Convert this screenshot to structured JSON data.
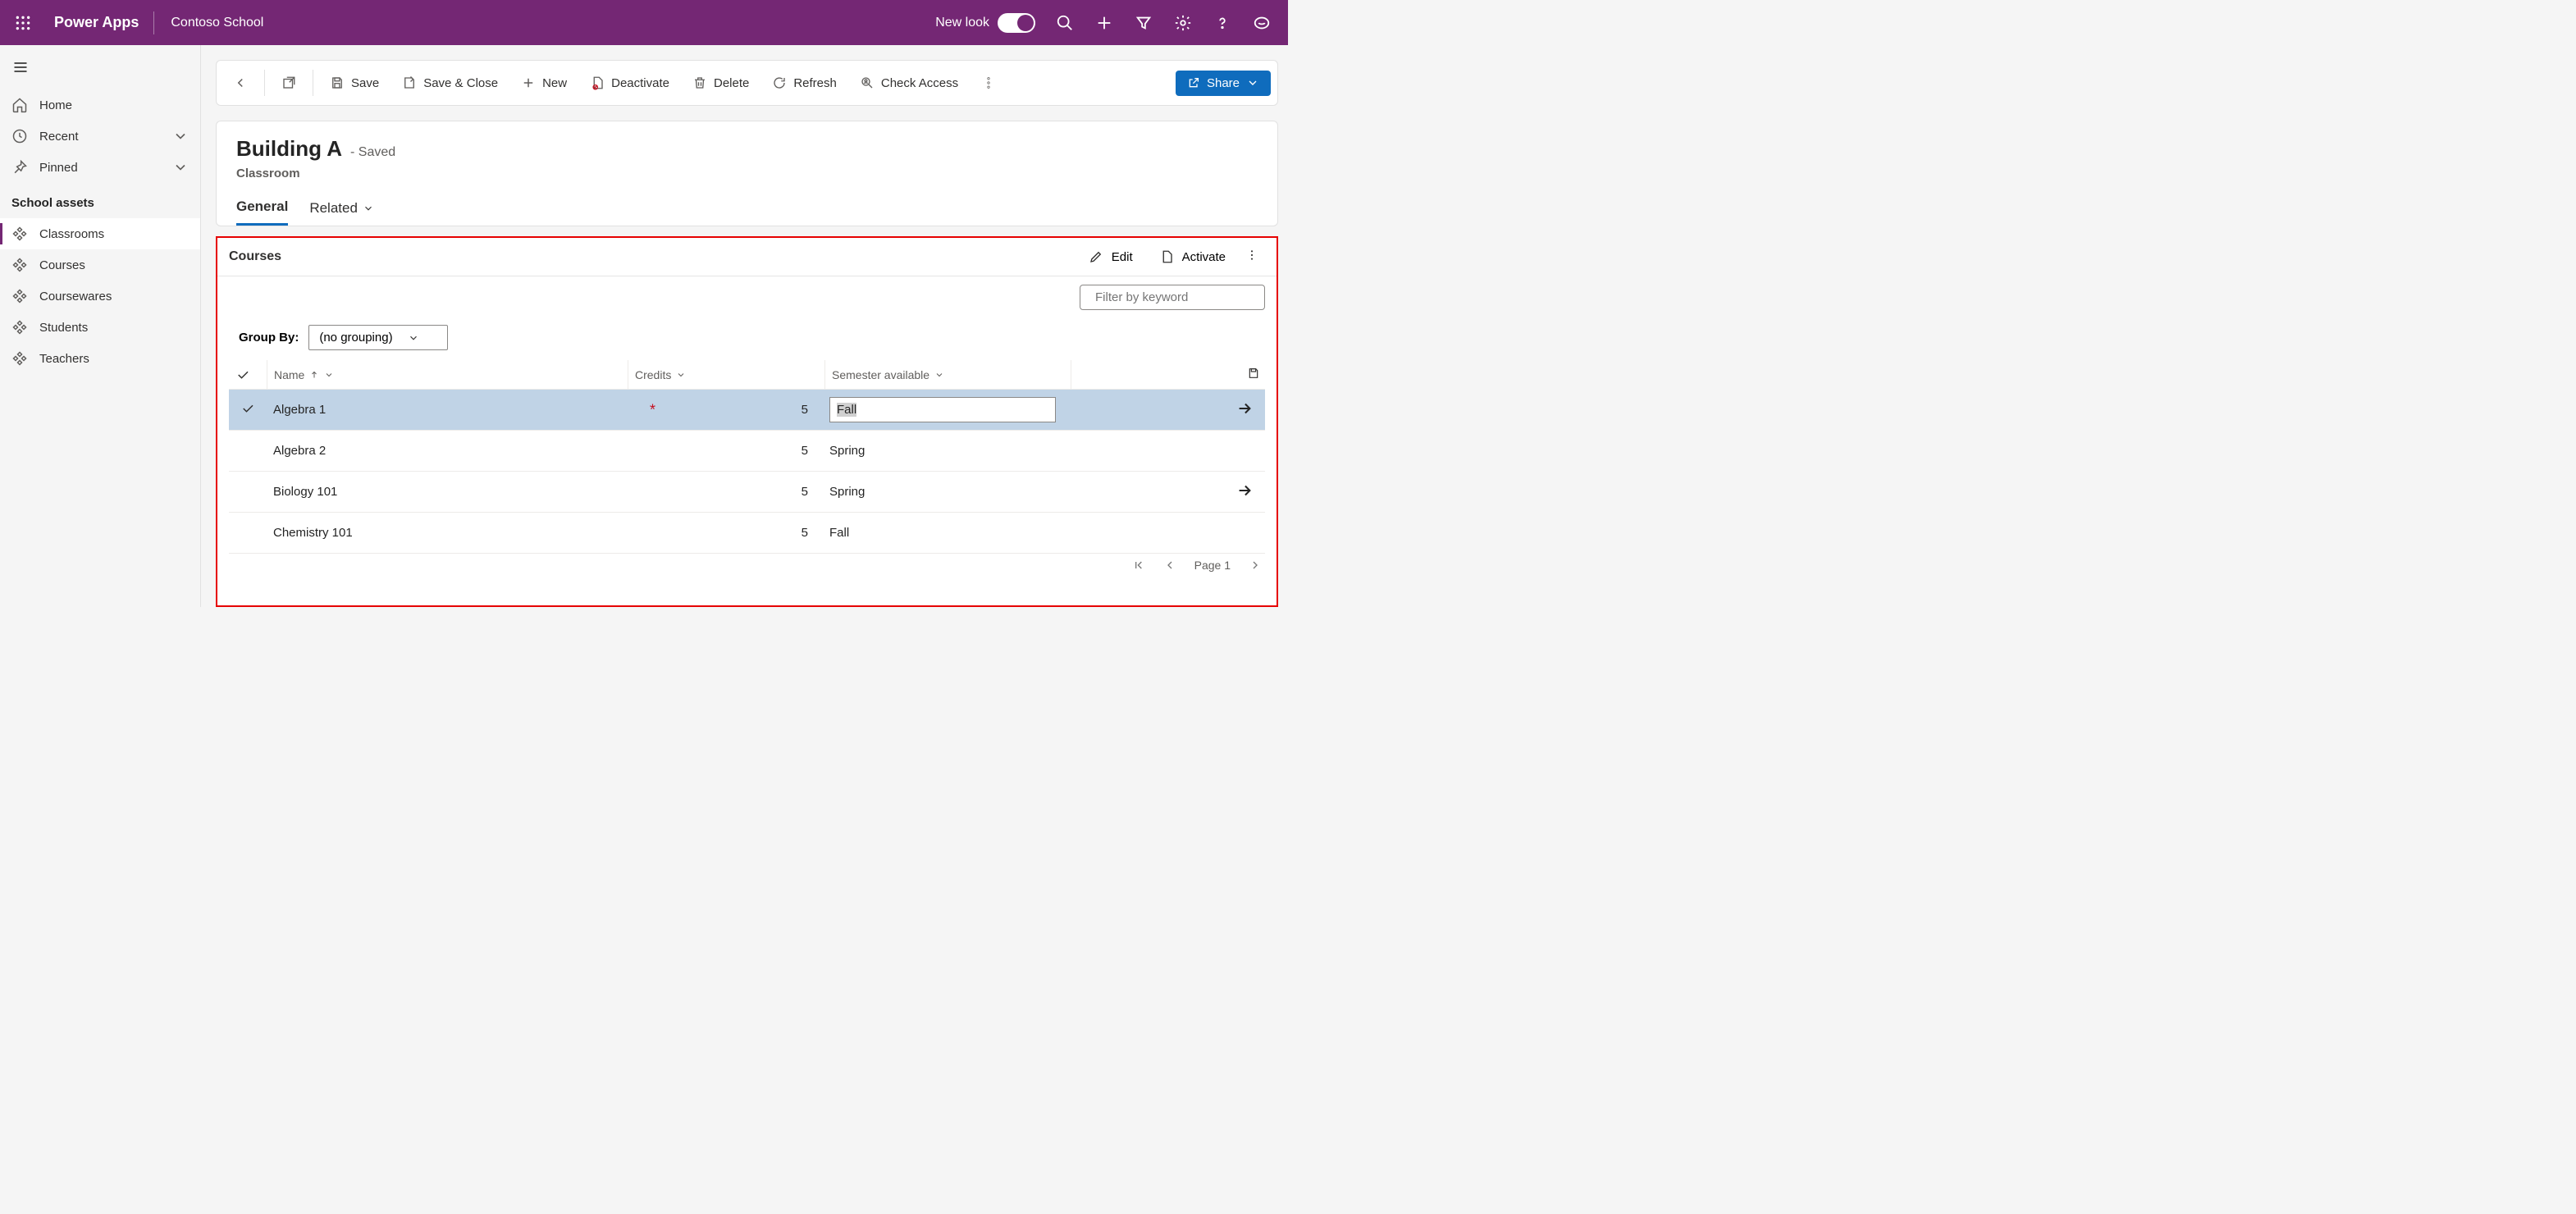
{
  "header": {
    "app_title": "Power Apps",
    "org_name": "Contoso School",
    "new_look_label": "New look"
  },
  "nav": {
    "home": "Home",
    "recent": "Recent",
    "pinned": "Pinned",
    "section_title": "School assets",
    "items": [
      "Classrooms",
      "Courses",
      "Coursewares",
      "Students",
      "Teachers"
    ]
  },
  "commands": {
    "save": "Save",
    "save_close": "Save & Close",
    "new": "New",
    "deactivate": "Deactivate",
    "delete": "Delete",
    "refresh": "Refresh",
    "check_access": "Check Access",
    "share": "Share"
  },
  "record": {
    "title": "Building A",
    "saved_suffix": "- Saved",
    "subtitle": "Classroom",
    "tab_general": "General",
    "tab_related": "Related"
  },
  "subgrid": {
    "title": "Courses",
    "edit": "Edit",
    "activate": "Activate",
    "filter_placeholder": "Filter by keyword",
    "groupby_label": "Group By:",
    "groupby_value": "(no grouping)",
    "col_name": "Name",
    "col_credits": "Credits",
    "col_semester": "Semester available",
    "rows": [
      {
        "name": "Algebra 1",
        "credits": "5",
        "semester": "Fall",
        "selected": true,
        "editing": true,
        "arrow": true
      },
      {
        "name": "Algebra 2",
        "credits": "5",
        "semester": "Spring",
        "selected": false,
        "editing": false,
        "arrow": false
      },
      {
        "name": "Biology 101",
        "credits": "5",
        "semester": "Spring",
        "selected": false,
        "editing": false,
        "arrow": true
      },
      {
        "name": "Chemistry 101",
        "credits": "5",
        "semester": "Fall",
        "selected": false,
        "editing": false,
        "arrow": false
      }
    ],
    "pager": "Page 1"
  }
}
